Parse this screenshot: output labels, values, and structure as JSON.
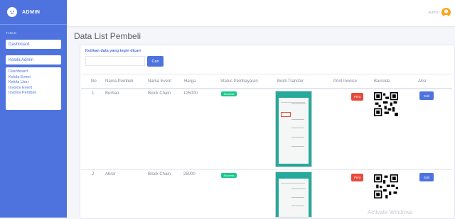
{
  "sidebar": {
    "brand": "ADMIN",
    "section_label": "TABLE",
    "items": [
      {
        "label": "Dashboard"
      },
      {
        "label": "Kelola Admin"
      }
    ],
    "group": [
      "Dashboard",
      "Kelola Event",
      "Kelola User",
      "Invoice Event",
      "Invoice Pembeli"
    ]
  },
  "topbar": {
    "admin_name": "Admin"
  },
  "page": {
    "title": "Data List Pembeli",
    "search_label": "Ketikan data yang ingin dicari",
    "search_value": "",
    "search_button": "Cari"
  },
  "table": {
    "headers": [
      "No",
      "Nama Pembeli",
      "Nama Event",
      "Harga",
      "Status Pembayaran",
      "Bukti Transfer",
      "Print Invoice",
      "Barcode",
      "Aksi"
    ],
    "rows": [
      {
        "no": "1",
        "nama": "Burhan",
        "event": "Block Chain",
        "harga": "125000",
        "status": "Success",
        "print": "Print",
        "edit": "Edit"
      },
      {
        "no": "2",
        "nama": "Abror",
        "event": "Block Chain",
        "harga": "25000",
        "status": "Success",
        "print": "Print",
        "edit": "Edit"
      }
    ]
  },
  "watermark": "Activate Windows",
  "colors": {
    "primary": "#4e73df",
    "success": "#1cc88a",
    "danger": "#e74a3b"
  },
  "icons": {
    "brand": "smile-face-icon",
    "avatar": "user-avatar-icon"
  }
}
